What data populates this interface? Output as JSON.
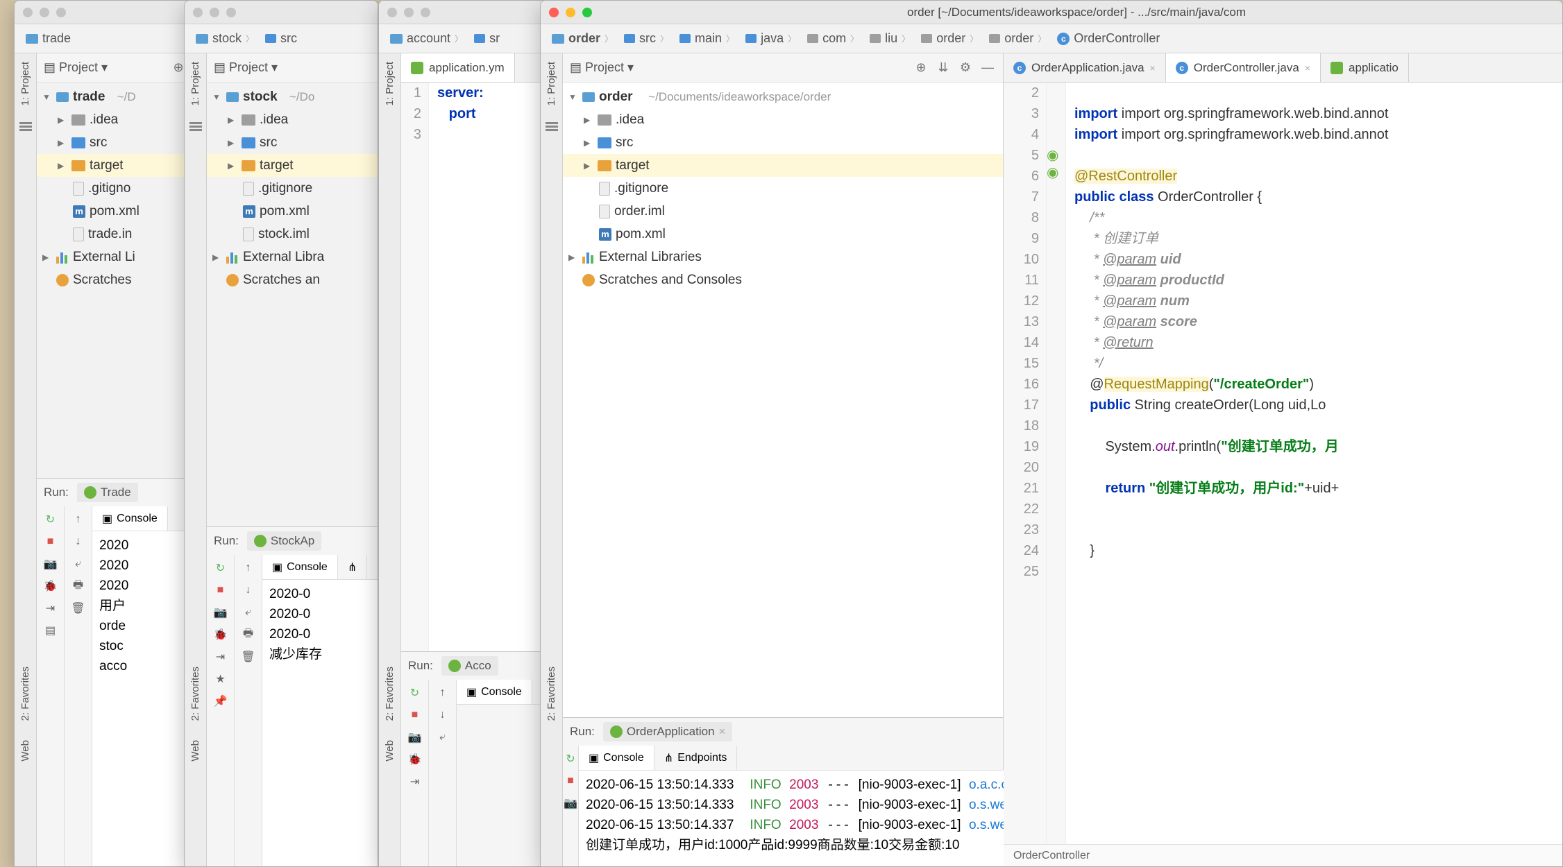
{
  "windows": {
    "trade": {
      "crumb": "trade",
      "project_label": "Project",
      "root": "trade",
      "root_hint": "~/D",
      "items": [
        ".idea",
        "src",
        "target",
        ".gitigno",
        "pom.xml",
        "trade.in"
      ],
      "ext_lib": "External Li",
      "scratches": "Scratches",
      "run_label": "Run:",
      "run_config": "Trade",
      "console_tab": "Console",
      "console": [
        "2020",
        "2020",
        "2020",
        "用户",
        "orde",
        "stoc",
        "acco"
      ]
    },
    "stock": {
      "crumb1": "stock",
      "crumb2": "src",
      "project_label": "Project",
      "root": "stock",
      "root_hint": "~/Do",
      "items": [
        ".idea",
        "src",
        "target",
        ".gitignore",
        "pom.xml",
        "stock.iml"
      ],
      "ext_lib": "External Libra",
      "scratches": "Scratches an",
      "run_label": "Run:",
      "run_config": "StockAp",
      "console_tab": "Console",
      "console": [
        "2020-0",
        "2020-0",
        "2020-0",
        "减少库存"
      ]
    },
    "account": {
      "crumb1": "account",
      "crumb2": "sr",
      "tab": "application.ym",
      "yml_lines": [
        "server:",
        "  port",
        ""
      ],
      "run_label": "Run:",
      "run_config": "Acco",
      "console_tab": "Console"
    },
    "order": {
      "title": "order [~/Documents/ideaworkspace/order] - .../src/main/java/com",
      "breadcrumbs": [
        "order",
        "src",
        "main",
        "java",
        "com",
        "liu",
        "order",
        "order",
        "OrderController"
      ],
      "project_label": "Project",
      "root": "order",
      "root_hint": "~/Documents/ideaworkspace/order",
      "tree": [
        ".idea",
        "src",
        "target",
        ".gitignore",
        "order.iml",
        "pom.xml"
      ],
      "ext_lib": "External Libraries",
      "scratches": "Scratches and Consoles",
      "tabs": [
        {
          "label": "OrderApplication.java",
          "active": false
        },
        {
          "label": "OrderController.java",
          "active": true
        },
        {
          "label": "applicatio",
          "active": false
        }
      ],
      "code_start": 2,
      "crumb_bar": "OrderController",
      "run_label": "Run:",
      "run_config": "OrderApplication",
      "console_tab": "Console",
      "endpoints_tab": "Endpoints",
      "console_lines": [
        {
          "ts": "2020-06-15 13:50:14.333",
          "lvl": "INFO",
          "pid": "2003",
          "thread": "[nio-9003-exec-1]",
          "cls": "o.a.c.c.C.[Tomcat].[loca"
        },
        {
          "ts": "2020-06-15 13:50:14.333",
          "lvl": "INFO",
          "pid": "2003",
          "thread": "[nio-9003-exec-1]",
          "cls": "o.s.web.servlet.Dispatch"
        },
        {
          "ts": "2020-06-15 13:50:14.337",
          "lvl": "INFO",
          "pid": "2003",
          "thread": "[nio-9003-exec-1]",
          "cls": "o.s.web.servlet.Dispatch"
        }
      ],
      "console_msg": "创建订单成功，用户id:1000产品id:9999商品数量:10交易金额:10"
    }
  },
  "sidebar_tabs": {
    "project": "1: Project",
    "favorites": "2: Favorites",
    "web": "Web"
  },
  "code": {
    "l3": "import org.springframework.web.bind.annot",
    "l4": "import org.springframework.web.bind.annot",
    "l6": "@RestController",
    "l7a": "public class",
    "l7b": " OrderController {",
    "l8": "    /**",
    "l9": "     * 创建订单",
    "l10a": "     * ",
    "l10b": "@param",
    "l10c": " uid",
    "l11a": "     * ",
    "l11b": "@param",
    "l11c": " productId",
    "l12a": "     * ",
    "l12b": "@param",
    "l12c": " num",
    "l13a": "     * ",
    "l13b": "@param",
    "l13c": " score",
    "l14a": "     * ",
    "l14b": "@return",
    "l15": "     */",
    "l16a": "    @",
    "l16b": "RequestMapping",
    "l16c": "(",
    "l16d": "\"/createOrder\"",
    "l16e": ")",
    "l17a": "    public",
    "l17b": " String createOrder(Long uid,Lo",
    "l19a": "        System.",
    "l19b": "out",
    "l19c": ".println(",
    "l19d": "\"创建订单成功，月",
    "l21a": "        return ",
    "l21b": "\"创建订单成功，用户id:\"",
    "l21c": "+uid+",
    "l24": "    }",
    "l25": ""
  }
}
